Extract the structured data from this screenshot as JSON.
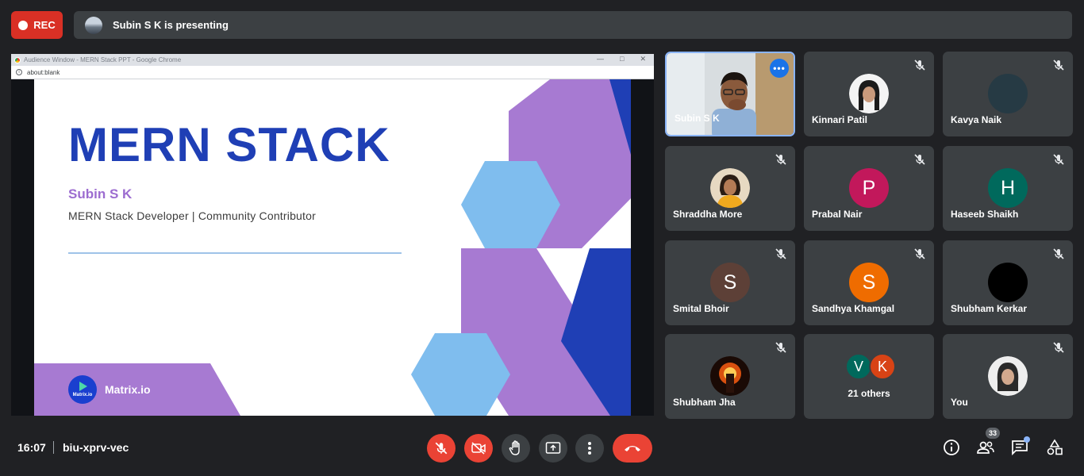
{
  "top_bar": {
    "rec_label": "REC",
    "presenting_text": "Subin S K is presenting"
  },
  "share": {
    "window_title": "Audience Window - MERN Stack PPT - Google Chrome",
    "url": "about:blank",
    "slide": {
      "title": "MERN STACK",
      "name": "Subin S K",
      "subtitle": "MERN Stack Developer | Community Contributor",
      "brand": "Matrix.io",
      "brand_logo_text": "Matrix.io"
    }
  },
  "participants": [
    {
      "name": "Subin S K",
      "type": "video"
    },
    {
      "name": "Kinnari Patil",
      "type": "photo"
    },
    {
      "name": "Kavya Naik",
      "type": "plain"
    },
    {
      "name": "Shraddha More",
      "type": "photo"
    },
    {
      "name": "Prabal Nair",
      "type": "letter",
      "letter": "P",
      "color": "#c2185b"
    },
    {
      "name": "Haseeb Shaikh",
      "type": "letter",
      "letter": "H",
      "color": "#00695c"
    },
    {
      "name": "Smital Bhoir",
      "type": "letter",
      "letter": "S",
      "color": "#5d4037"
    },
    {
      "name": "Sandhya Khamgal",
      "type": "letter",
      "letter": "S",
      "color": "#ef6c00"
    },
    {
      "name": "Shubham Kerkar",
      "type": "plain"
    },
    {
      "name": "Shubham Jha",
      "type": "photo"
    },
    {
      "name": "You",
      "type": "photo"
    }
  ],
  "others": {
    "label": "21 others",
    "avatars": [
      {
        "letter": "V",
        "color": "#00695c"
      },
      {
        "letter": "K",
        "color": "#d84315"
      }
    ]
  },
  "bottom_bar": {
    "time": "16:07",
    "meeting_code": "biu-xprv-vec",
    "people_count": "33"
  }
}
